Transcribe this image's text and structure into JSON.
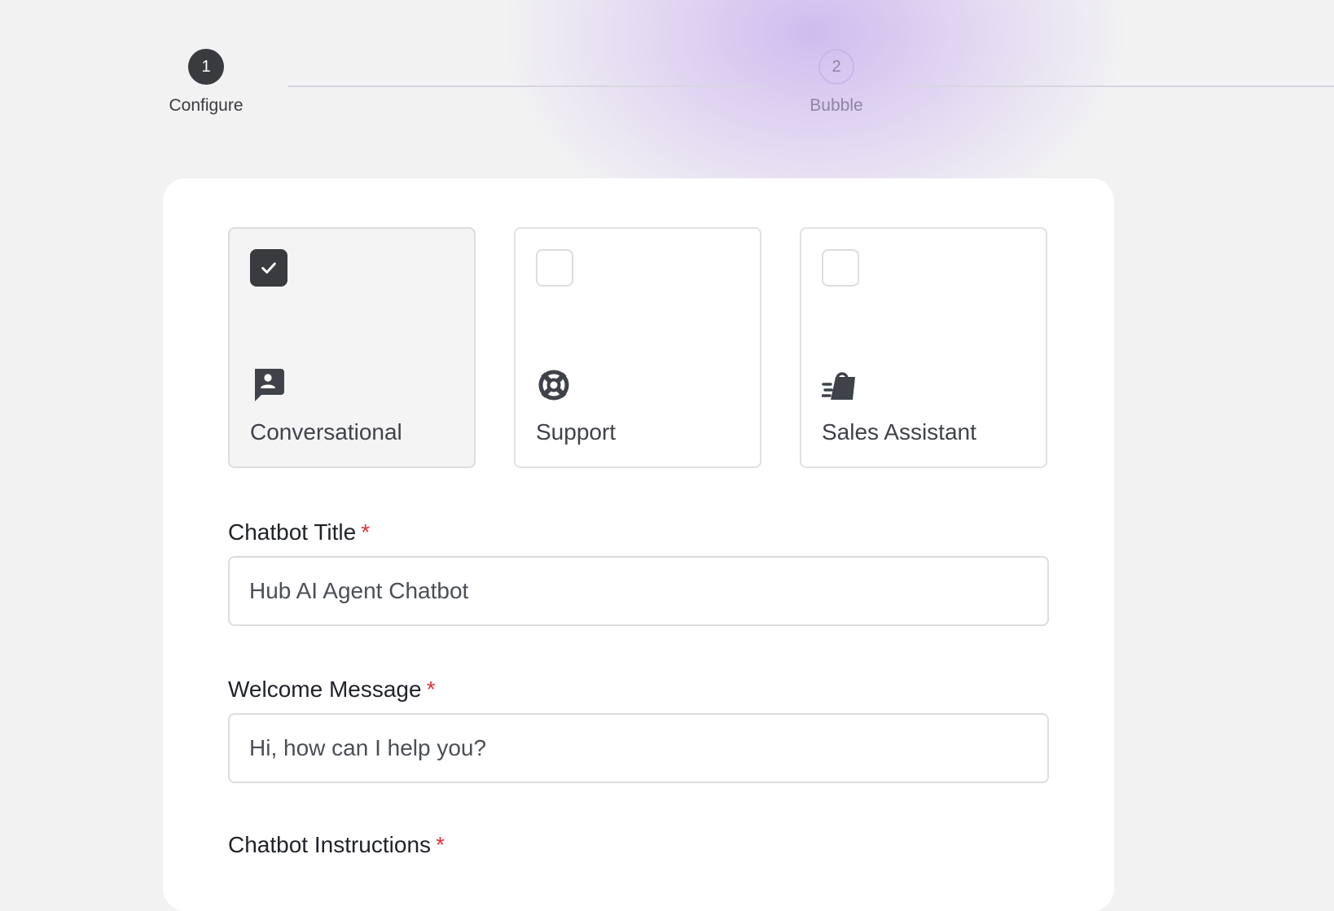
{
  "stepper": {
    "steps": [
      {
        "number": "1",
        "label": "Configure",
        "state": "active"
      },
      {
        "number": "2",
        "label": "Bubble",
        "state": "upcoming"
      }
    ]
  },
  "chatbot_types": [
    {
      "label": "Conversational",
      "icon": "chat-person-icon",
      "selected": true
    },
    {
      "label": "Support",
      "icon": "lifebuoy-icon",
      "selected": false
    },
    {
      "label": "Sales Assistant",
      "icon": "fast-shopping-bag-icon",
      "selected": false
    }
  ],
  "form": {
    "chatbot_title": {
      "label": "Chatbot Title",
      "required_mark": "*",
      "value": "Hub AI Agent Chatbot"
    },
    "welcome_message": {
      "label": "Welcome Message",
      "required_mark": "*",
      "value": "Hi, how can I help you?"
    },
    "chatbot_instructions": {
      "label": "Chatbot Instructions",
      "required_mark": "*"
    }
  },
  "colors": {
    "accent_dark": "#3a3b3f",
    "required": "#e0303b",
    "glow": "#c9b7e8"
  }
}
